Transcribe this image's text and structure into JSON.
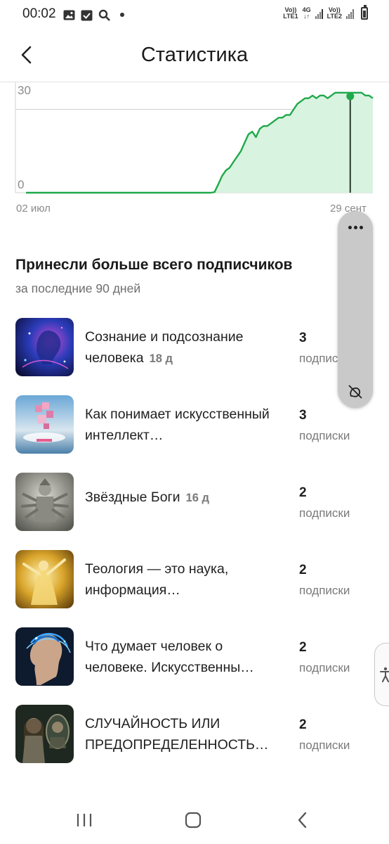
{
  "status_bar": {
    "time": "00:02",
    "sim1_label_top": "Vo))",
    "sim1_label_bottom": "LTE1",
    "net_label_top": "4G",
    "sim2_label_top": "Vo))",
    "sim2_label_bottom": "LTE2",
    "icons": [
      "gallery-icon",
      "calendar-check-icon",
      "search-icon",
      "dot-icon",
      "signal-icon",
      "battery-icon"
    ],
    "battery_level": 0.85
  },
  "header": {
    "title": "Статистика",
    "back_icon": "chevron-left-icon"
  },
  "chart_data": {
    "type": "area",
    "title": "",
    "xlabel": "",
    "ylabel": "",
    "x_tick_labels": [
      "02 июл",
      "29 сент"
    ],
    "y_tick_labels": [
      "0",
      "30"
    ],
    "ylim": [
      0,
      40
    ],
    "grid": true,
    "color": "#1fa94a",
    "fill_color": "#d8f3df",
    "selected_day_index": 86,
    "series": [
      {
        "values": [
          0,
          0,
          0,
          0,
          0,
          0,
          0,
          0,
          0,
          0,
          0,
          0,
          0,
          0,
          0,
          0,
          0,
          0,
          0,
          0,
          0,
          0,
          0,
          0,
          0,
          0,
          0,
          0,
          0,
          0,
          0,
          0,
          0,
          0,
          0,
          0,
          0,
          0,
          0,
          0,
          0,
          0,
          0,
          0,
          0,
          0,
          0,
          0,
          0,
          0,
          0.2,
          3,
          6,
          8,
          9,
          11,
          13,
          15,
          18,
          21,
          22,
          20,
          23,
          24,
          24,
          25,
          26,
          27,
          27,
          28,
          28,
          30,
          32,
          33,
          34,
          34,
          35,
          34,
          35,
          35,
          34,
          35,
          36,
          36,
          36,
          36,
          36,
          36,
          36,
          36,
          35,
          35,
          34
        ]
      }
    ]
  },
  "section": {
    "title": "Принесли больше всего подписчиков",
    "subtitle": "за последние 90 дней"
  },
  "items": [
    {
      "title": "Сознание и подсознание человека",
      "age": "18 д",
      "count": "3",
      "unit": "подписки"
    },
    {
      "title": "Как понимает искусственный интеллект…",
      "age": "",
      "count": "3",
      "unit": "подписки"
    },
    {
      "title": "Звёздные Боги",
      "age": "16 д",
      "count": "2",
      "unit": "подписки"
    },
    {
      "title": "Теология — это наука, информация…",
      "age": "",
      "count": "2",
      "unit": "подписки"
    },
    {
      "title": "Что думает человек о человеке. Искусственны…",
      "age": "",
      "count": "2",
      "unit": "подписки"
    },
    {
      "title": "СЛУЧАЙНОСТЬ ИЛИ ПРЕДОПРЕДЕЛЕННОСТЬ…",
      "age": "",
      "count": "2",
      "unit": "подписки"
    }
  ],
  "floating_panel": {
    "more_icon": "more-horizontal-icon",
    "hide_icon": "hide-panel-icon"
  },
  "accessibility_icon": "accessibility-icon",
  "nav_bar": {
    "recents_icon": "recents-icon",
    "home_icon": "home-icon",
    "back_icon": "back-icon"
  }
}
